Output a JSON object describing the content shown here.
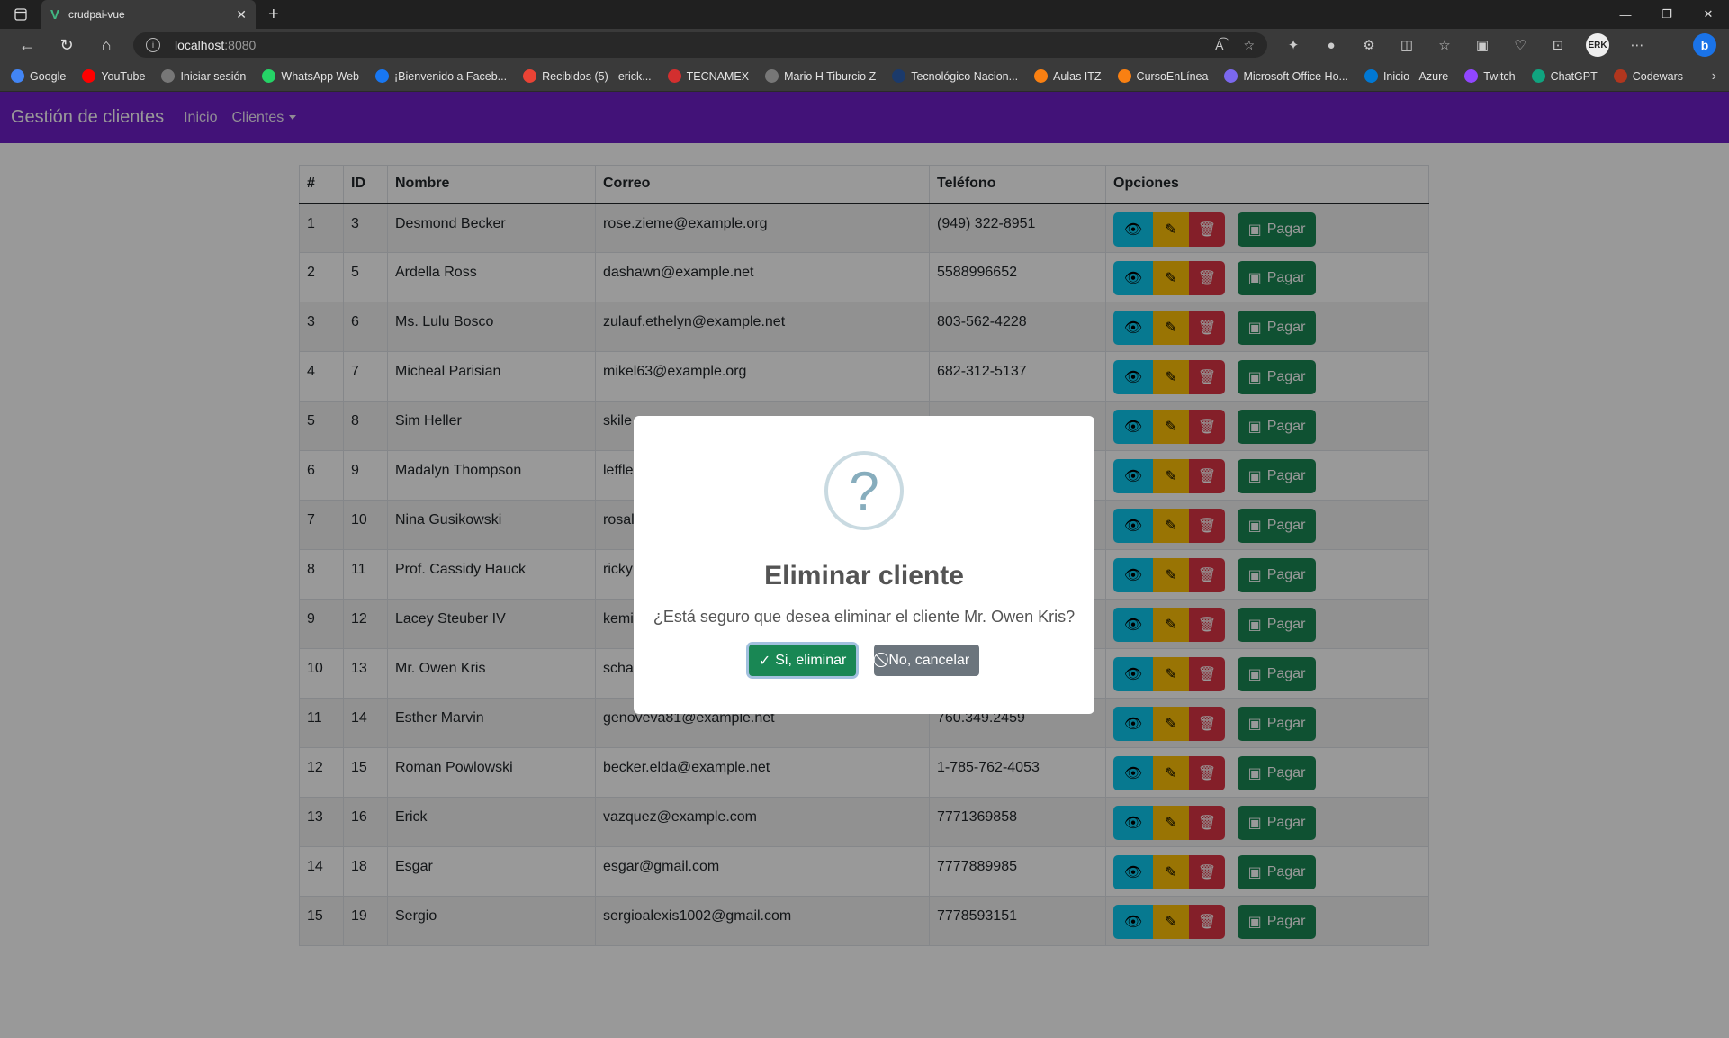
{
  "browser": {
    "tab_title": "crudpai-vue",
    "url_host": "localhost",
    "url_port": ":8080",
    "profile_initials": "ERK",
    "bookmarks": [
      {
        "label": "Google",
        "icon": "google-icon",
        "color": "#4285f4"
      },
      {
        "label": "YouTube",
        "icon": "youtube-icon",
        "color": "#ff0000"
      },
      {
        "label": "Iniciar sesión",
        "icon": "page-icon",
        "color": "#777777"
      },
      {
        "label": "WhatsApp Web",
        "icon": "whatsapp-icon",
        "color": "#25d366"
      },
      {
        "label": "¡Bienvenido a Faceb...",
        "icon": "facebook-icon",
        "color": "#1877f2"
      },
      {
        "label": "Recibidos (5) - erick...",
        "icon": "gmail-icon",
        "color": "#ea4335"
      },
      {
        "label": "TECNAMEX",
        "icon": "tecnamex-icon",
        "color": "#d32f2f"
      },
      {
        "label": "Mario H Tiburcio Z",
        "icon": "page-icon",
        "color": "#777777"
      },
      {
        "label": "Tecnológico Nacion...",
        "icon": "tecnm-icon",
        "color": "#1b3a6b"
      },
      {
        "label": "Aulas ITZ",
        "icon": "moodle-icon",
        "color": "#f98012"
      },
      {
        "label": "CursoEnLínea",
        "icon": "moodle-icon",
        "color": "#f98012"
      },
      {
        "label": "Microsoft Office Ho...",
        "icon": "office-icon",
        "color": "#7b68ee"
      },
      {
        "label": "Inicio - Azure",
        "icon": "azure-icon",
        "color": "#0078d4"
      },
      {
        "label": "Twitch",
        "icon": "twitch-icon",
        "color": "#9146ff"
      },
      {
        "label": "ChatGPT",
        "icon": "chatgpt-icon",
        "color": "#10a37f"
      },
      {
        "label": "Codewars",
        "icon": "codewars-icon",
        "color": "#b1361e"
      }
    ]
  },
  "app": {
    "brand": "Gestión de clientes",
    "nav_home": "Inicio",
    "nav_clients": "Clientes",
    "nav_color": "#6f1fc9"
  },
  "table": {
    "headers": [
      "#",
      "ID",
      "Nombre",
      "Correo",
      "Teléfono",
      "Opciones"
    ],
    "pay_label": "Pagar",
    "rows": [
      {
        "n": "1",
        "id": "3",
        "name": "Desmond Becker",
        "email": "rose.zieme@example.org",
        "phone": "(949) 322-8951"
      },
      {
        "n": "2",
        "id": "5",
        "name": "Ardella Ross",
        "email": "dashawn@example.net",
        "phone": "5588996652"
      },
      {
        "n": "3",
        "id": "6",
        "name": "Ms. Lulu Bosco",
        "email": "zulauf.ethelyn@example.net",
        "phone": "803-562-4228"
      },
      {
        "n": "4",
        "id": "7",
        "name": "Micheal Parisian",
        "email": "mikel63@example.org",
        "phone": "682-312-5137"
      },
      {
        "n": "5",
        "id": "8",
        "name": "Sim Heller",
        "email": "skile",
        "phone": ""
      },
      {
        "n": "6",
        "id": "9",
        "name": "Madalyn Thompson",
        "email": "leffle",
        "phone": ""
      },
      {
        "n": "7",
        "id": "10",
        "name": "Nina Gusikowski",
        "email": "rosal",
        "phone": ""
      },
      {
        "n": "8",
        "id": "11",
        "name": "Prof. Cassidy Hauck",
        "email": "ricky",
        "phone": ""
      },
      {
        "n": "9",
        "id": "12",
        "name": "Lacey Steuber IV",
        "email": "kemi",
        "phone": ""
      },
      {
        "n": "10",
        "id": "13",
        "name": "Mr. Owen Kris",
        "email": "scha",
        "phone": ""
      },
      {
        "n": "11",
        "id": "14",
        "name": "Esther Marvin",
        "email": "genoveva81@example.net",
        "phone": "760.349.2459"
      },
      {
        "n": "12",
        "id": "15",
        "name": "Roman Powlowski",
        "email": "becker.elda@example.net",
        "phone": "1-785-762-4053"
      },
      {
        "n": "13",
        "id": "16",
        "name": "Erick",
        "email": "vazquez@example.com",
        "phone": "7771369858"
      },
      {
        "n": "14",
        "id": "18",
        "name": "Esgar",
        "email": "esgar@gmail.com",
        "phone": "7777889985"
      },
      {
        "n": "15",
        "id": "19",
        "name": "Sergio",
        "email": "sergioalexis1002@gmail.com",
        "phone": "7778593151"
      }
    ]
  },
  "modal": {
    "icon": "?",
    "title": "Eliminar cliente",
    "text": "¿Está seguro que desea eliminar el cliente Mr. Owen Kris?",
    "confirm": "Si, eliminar",
    "cancel": "No, cancelar"
  }
}
